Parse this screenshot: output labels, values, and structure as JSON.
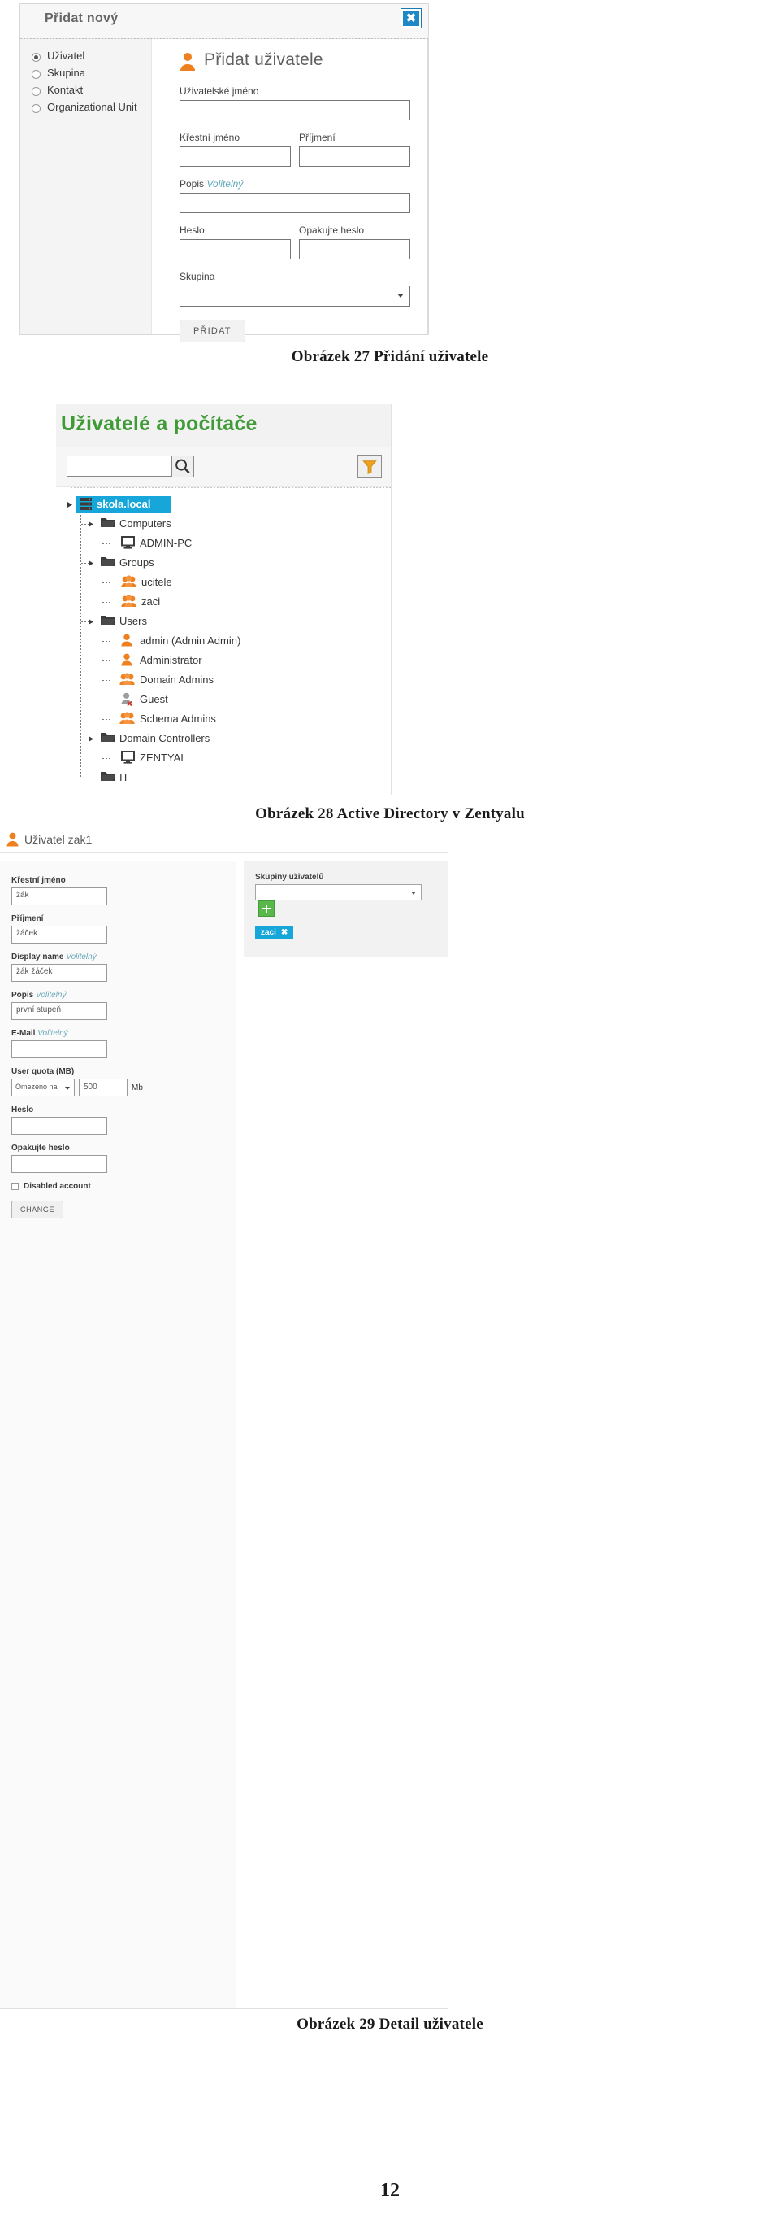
{
  "figure27": {
    "window_title": "Přidat nový",
    "close_label": "✖",
    "type_options": [
      {
        "label": "Uživatel",
        "selected": true
      },
      {
        "label": "Skupina",
        "selected": false
      },
      {
        "label": "Kontakt",
        "selected": false
      },
      {
        "label": "Organizational Unit",
        "selected": false
      }
    ],
    "panel_heading": "Přidat uživatele",
    "fields": {
      "username_label": "Uživatelské jméno",
      "username_value": "",
      "firstname_label": "Křestní jméno",
      "firstname_value": "",
      "surname_label": "Příjmení",
      "surname_value": "",
      "description_label": "Popis",
      "description_optional": "Volitelný",
      "description_value": "",
      "password_label": "Heslo",
      "password_value": "",
      "password_repeat_label": "Opakujte heslo",
      "password_repeat_value": "",
      "group_label": "Skupina",
      "group_value": ""
    },
    "submit_label": "PŘIDAT",
    "caption": "Obrázek 27 Přidání uživatele"
  },
  "figure28": {
    "title": "Uživatelé a počítače",
    "search_value": "",
    "search_icon": "search-icon",
    "filter_icon": "filter-icon",
    "tree": [
      {
        "label": "skola.local",
        "icon": "server-icon",
        "depth": 0,
        "selected": true,
        "expander": true
      },
      {
        "label": "Computers",
        "icon": "folder-icon",
        "depth": 1,
        "selected": false,
        "expander": true
      },
      {
        "label": "ADMIN-PC",
        "icon": "computer-icon",
        "depth": 2,
        "selected": false,
        "expander": false
      },
      {
        "label": "Groups",
        "icon": "folder-icon",
        "depth": 1,
        "selected": false,
        "expander": true
      },
      {
        "label": "ucitele",
        "icon": "group-icon",
        "depth": 2,
        "selected": false,
        "expander": false
      },
      {
        "label": "zaci",
        "icon": "group-icon",
        "depth": 2,
        "selected": false,
        "expander": false
      },
      {
        "label": "Users",
        "icon": "folder-icon",
        "depth": 1,
        "selected": false,
        "expander": true
      },
      {
        "label": "admin (Admin Admin)",
        "icon": "user-icon",
        "depth": 2,
        "selected": false,
        "expander": false
      },
      {
        "label": "Administrator",
        "icon": "user-icon",
        "depth": 2,
        "selected": false,
        "expander": false
      },
      {
        "label": "Domain Admins",
        "icon": "group-icon",
        "depth": 2,
        "selected": false,
        "expander": false
      },
      {
        "label": "Guest",
        "icon": "user-disabled-icon",
        "depth": 2,
        "selected": false,
        "expander": false
      },
      {
        "label": "Schema Admins",
        "icon": "group-icon",
        "depth": 2,
        "selected": false,
        "expander": false
      },
      {
        "label": "Domain Controllers",
        "icon": "folder-icon",
        "depth": 1,
        "selected": false,
        "expander": true
      },
      {
        "label": "ZENTYAL",
        "icon": "computer-icon",
        "depth": 2,
        "selected": false,
        "expander": false
      },
      {
        "label": "IT",
        "icon": "folder-icon",
        "depth": 1,
        "selected": false,
        "expander": false
      }
    ],
    "caption": "Obrázek 28 Active Directory v Zentyalu"
  },
  "figure29": {
    "header_title": "Uživatel zak1",
    "header_icon": "user-icon",
    "fields": [
      {
        "label": "Křestní jméno",
        "optional": "",
        "value": "žák",
        "name": "firstname"
      },
      {
        "label": "Příjmení",
        "optional": "",
        "value": "žáček",
        "name": "surname"
      },
      {
        "label": "Display name",
        "optional": "Volitelný",
        "value": "žák žáček",
        "name": "display-name"
      },
      {
        "label": "Popis",
        "optional": "Volitelný",
        "value": "první stupeň",
        "name": "description"
      },
      {
        "label": "E-Mail",
        "optional": "Volitelný",
        "value": "",
        "name": "email"
      }
    ],
    "quota": {
      "label": "User quota (MB)",
      "mode": "Omezeno na",
      "value": "500",
      "unit": "Mb"
    },
    "password": {
      "label": "Heslo",
      "value": "",
      "repeat_label": "Opakujte heslo",
      "repeat_value": ""
    },
    "disabled_account_label": "Disabled account",
    "disabled_account_checked": false,
    "submit_label": "CHANGE",
    "groups_panel": {
      "title": "Skupiny uživatelů",
      "select_value": "",
      "add_label": "+",
      "tags": [
        {
          "label": "zaci",
          "remove": "✖"
        }
      ]
    },
    "caption": "Obrázek 29 Detail uživatele"
  },
  "page_number": "12"
}
